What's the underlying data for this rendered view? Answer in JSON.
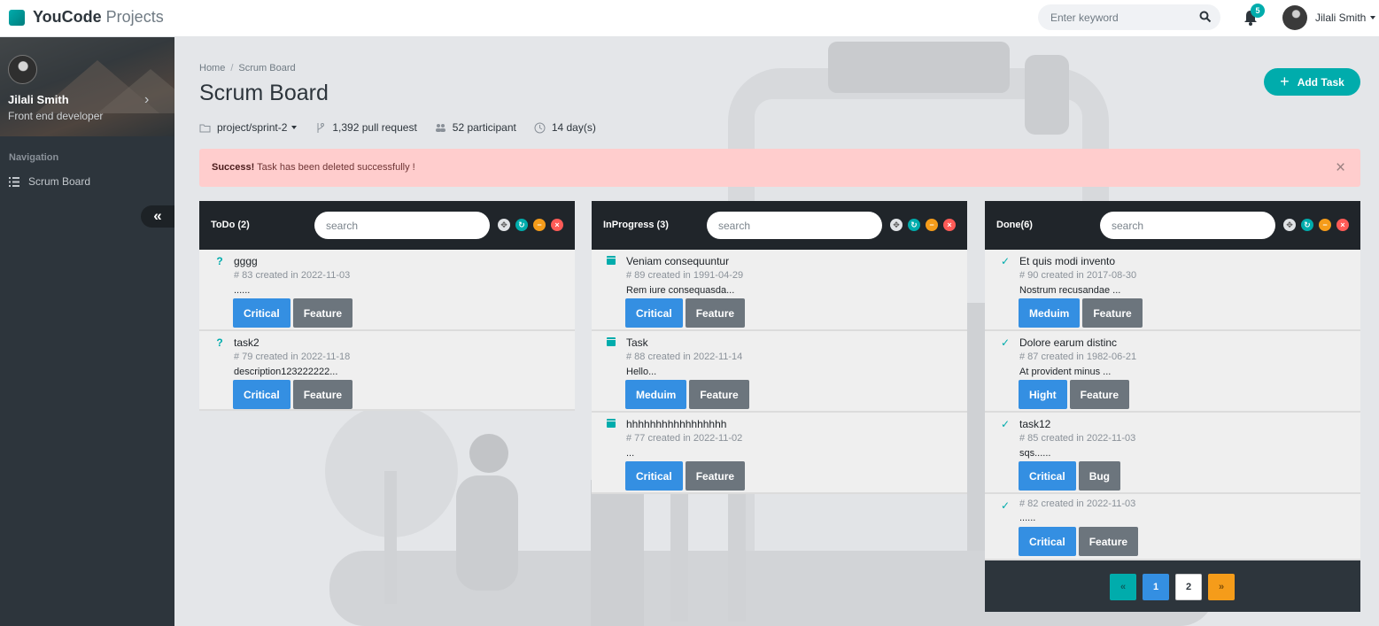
{
  "header": {
    "brand_name": "YouCode",
    "brand_sub": "Projects",
    "search_placeholder": "Enter keyword",
    "notification_count": "5",
    "user_name": "Jilali Smith"
  },
  "sidebar": {
    "profile_name": "Jilali Smith",
    "profile_role": "Front end developer",
    "nav_header": "Navigation",
    "nav_items": [
      {
        "label": "Scrum Board",
        "icon": "list-icon"
      }
    ],
    "collapse_label": "«"
  },
  "page": {
    "breadcrumb": [
      "Home",
      "Scrum Board"
    ],
    "breadcrumb_sep": "/",
    "title": "Scrum Board",
    "meta": {
      "branch": "project/sprint-2",
      "pull_requests": "1,392 pull request",
      "participants": "52 participant",
      "duration": "14 day(s)"
    },
    "add_task_label": "Add Task"
  },
  "alert": {
    "strong": "Success!",
    "text": "Task has been deleted successfully !",
    "close": "×"
  },
  "columns": [
    {
      "title": "ToDo (2)",
      "search_placeholder": "search",
      "status_icon": "question-icon",
      "tasks": [
        {
          "title": "gggg",
          "meta": "# 83 created in 2022-11-03",
          "desc": "......",
          "tags": [
            "Critical",
            "Feature"
          ]
        },
        {
          "title": "task2",
          "meta": "# 79 created in 2022-11-18",
          "desc": "description123222222...",
          "tags": [
            "Critical",
            "Feature"
          ]
        }
      ]
    },
    {
      "title": "InProgress (3)",
      "search_placeholder": "search",
      "status_icon": "calendar-icon",
      "tasks": [
        {
          "title": "Veniam consequuntur",
          "meta": "# 89 created in 1991-04-29",
          "desc": "Rem iure consequasda...",
          "tags": [
            "Critical",
            "Feature"
          ]
        },
        {
          "title": "Task",
          "meta": "# 88 created in 2022-11-14",
          "desc": "Hello...",
          "tags": [
            "Meduim",
            "Feature"
          ]
        },
        {
          "title": "hhhhhhhhhhhhhhhhh",
          "meta": "# 77 created in 2022-11-02",
          "desc": "...",
          "tags": [
            "Critical",
            "Feature"
          ]
        }
      ]
    },
    {
      "title": "Done(6)",
      "search_placeholder": "search",
      "status_icon": "check-icon",
      "tasks": [
        {
          "title": "Et quis modi invento",
          "meta": "# 90 created in 2017-08-30",
          "desc": "Nostrum recusandae ...",
          "tags": [
            "Meduim",
            "Feature"
          ]
        },
        {
          "title": "Dolore earum distinc",
          "meta": "# 87 created in 1982-06-21",
          "desc": "At provident minus ...",
          "tags": [
            "Hight",
            "Feature"
          ]
        },
        {
          "title": "task12",
          "meta": "# 85 created in 2022-11-03",
          "desc": "sqs......",
          "tags": [
            "Critical",
            "Bug"
          ]
        },
        {
          "title": "",
          "meta": "# 82 created in 2022-11-03",
          "desc": "......",
          "tags": [
            "Critical",
            "Feature"
          ]
        }
      ]
    }
  ],
  "pagination": {
    "first": "«",
    "pages": [
      "1",
      "2"
    ],
    "last": "»",
    "active": "1"
  },
  "colors": {
    "accent": "#00acac",
    "primary": "#348fe2",
    "warning": "#f59c1a",
    "danger": "#ff5b57",
    "sidebar": "#2d353c",
    "alert_bg": "#ffcdcd"
  }
}
